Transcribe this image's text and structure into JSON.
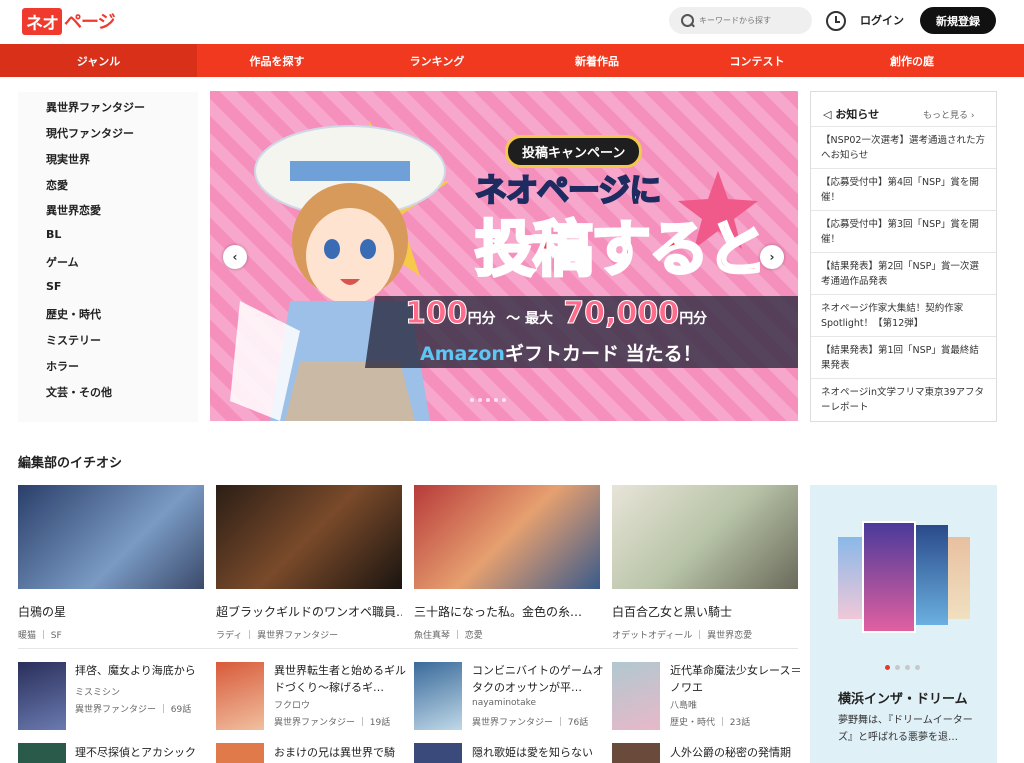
{
  "header": {
    "logo_box": "ネオ",
    "logo_rest": "ページ",
    "search_placeholder": "キーワードから探す",
    "login_label": "ログイン",
    "signup_label": "新規登録"
  },
  "nav": {
    "items": [
      {
        "label": "ジャンル"
      },
      {
        "label": "作品を探す"
      },
      {
        "label": "ランキング"
      },
      {
        "label": "新着作品"
      },
      {
        "label": "コンテスト"
      },
      {
        "label": "創作の庭"
      }
    ],
    "accent": "#f0391f"
  },
  "genres": [
    "異世界ファンタジー",
    "現代ファンタジー",
    "現実世界",
    "恋愛",
    "異世界恋愛",
    "BL",
    "ゲーム",
    "SF",
    "歴史・時代",
    "ミステリー",
    "ホラー",
    "文芸・その他"
  ],
  "banner": {
    "campaign_label": "投稿キャンペーン",
    "line1": "ネオページに",
    "line2": "投稿すると",
    "amount_a": "100",
    "amount_unit": "円分",
    "amount_sep": "〜 最大",
    "amount_b": "70,000",
    "gift_brand": "Amazon",
    "gift_rest": "ギフトカード 当たる！"
  },
  "news": {
    "title": "お知らせ",
    "more_label": "もっと見る",
    "items": [
      "【NSP02一次選考】選考通過された方へお知らせ",
      "【応募受付中】第4回「NSP」賞を開催！",
      "【応募受付中】第3回「NSP」賞を開催！",
      "【結果発表】第2回「NSP」賞一次選考通過作品発表",
      "ネオページ作家大集結！契約作家Spotlight！【第12弾】",
      "【結果発表】第1回「NSP」賞最終結果発表",
      "ネオページin文学フリマ東京39アフターレポート"
    ]
  },
  "picks": {
    "section_title": "編集部のイチオシ",
    "cards": [
      {
        "title": "白鴉の星",
        "author": "暖猫",
        "genre": "SF"
      },
      {
        "title": "超ブラックギルドのワンオペ職員…",
        "author": "ラディ",
        "genre": "異世界ファンタジー"
      },
      {
        "title": "三十路になった私。金色の糸…",
        "author": "魚住真琴",
        "genre": "恋愛"
      },
      {
        "title": "白百合乙女と黒い騎士",
        "author": "オデットオディール",
        "genre": "異世界恋愛"
      }
    ],
    "list": [
      {
        "title": "拝啓、魔女より海底から",
        "author": "ミスミシン",
        "genre": "異世界ファンタジー",
        "eps": "69話"
      },
      {
        "title": "異世界転生者と始めるギルドづくり〜稼げるギ…",
        "author": "フクロウ",
        "genre": "異世界ファンタジー",
        "eps": "19話"
      },
      {
        "title": "コンビニバイトのゲームオタクのオッサンが平…",
        "author": "nayaminotake",
        "genre": "異世界ファンタジー",
        "eps": "76話"
      },
      {
        "title": "近代革命魔法少女レース＝ノワエ",
        "author": "八島唯",
        "genre": "歴史・時代",
        "eps": "23話"
      },
      {
        "title": "理不尽探偵とアカシック",
        "author": "",
        "genre": "",
        "eps": ""
      },
      {
        "title": "おまけの兄は異世界で騎",
        "author": "",
        "genre": "",
        "eps": ""
      },
      {
        "title": "隠れ歌姫は愛を知らない",
        "author": "",
        "genre": "",
        "eps": ""
      },
      {
        "title": "人外公爵の秘密の発情期",
        "author": "",
        "genre": "",
        "eps": ""
      }
    ]
  },
  "feature": {
    "title": "横浜インザ・ドリーム",
    "desc": "夢野舞は、『ドリームイーターズ』と呼ばれる悪夢を退…"
  }
}
